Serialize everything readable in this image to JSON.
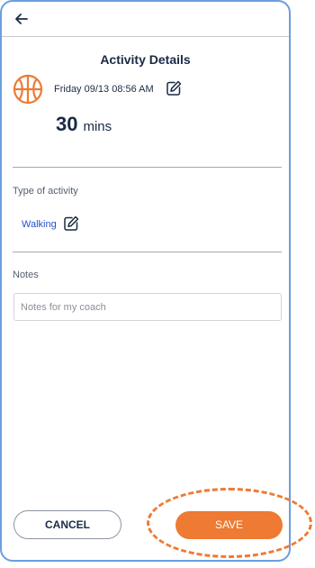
{
  "header": {
    "back_icon": "arrow-left-icon",
    "title": "Activity Details"
  },
  "activity": {
    "sport_icon": "basketball-icon",
    "datetime": "Friday 09/13 08:56 AM",
    "edit_icon": "pencil-edit-icon",
    "duration_value": "30",
    "duration_unit": "mins"
  },
  "type_section": {
    "label": "Type of activity",
    "value": "Walking",
    "edit_icon": "pencil-edit-icon"
  },
  "notes_section": {
    "label": "Notes",
    "placeholder": "Notes for my coach",
    "value": ""
  },
  "actions": {
    "cancel_label": "CANCEL",
    "save_label": "SAVE"
  },
  "colors": {
    "accent": "#ee7a33",
    "link": "#2850c8",
    "text": "#1a2a44",
    "frame_border": "#6b9ee0"
  }
}
